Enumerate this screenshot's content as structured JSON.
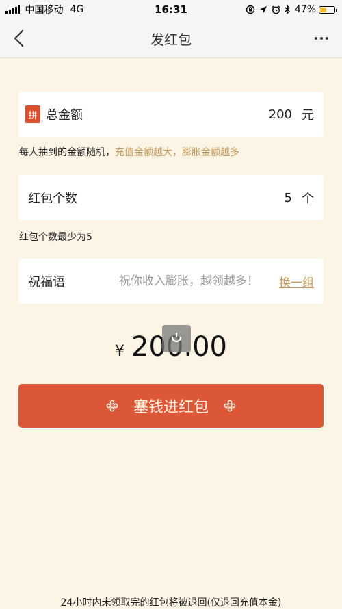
{
  "status_bar": {
    "carrier": "中国移动",
    "network": "4G",
    "time": "16:31",
    "battery_percent": "47%",
    "battery_level": 0.47
  },
  "nav": {
    "title": "发红包"
  },
  "amount_card": {
    "badge": "拼",
    "label": "总金额",
    "value": "200",
    "unit": "元"
  },
  "amount_hint": {
    "prefix": "每人抽到的金额随机，",
    "highlight": "充值金额越大，膨胀金额越多"
  },
  "count_card": {
    "label": "红包个数",
    "value": "5",
    "unit": "个"
  },
  "count_hint": "红包个数最少为5",
  "greeting_card": {
    "label": "祝福语",
    "placeholder": "祝你收入膨胀，越领越多！",
    "change_label": "换一组"
  },
  "total": {
    "currency": "¥",
    "value": "200.00"
  },
  "submit": {
    "label": "塞钱进红包"
  },
  "footer_note": "24小时内未领取完的红包将被退回(仅退回充值本金)",
  "colors": {
    "background": "#FCF4E4",
    "accent_red": "#DC5638",
    "accent_gold": "#C49A5A"
  }
}
